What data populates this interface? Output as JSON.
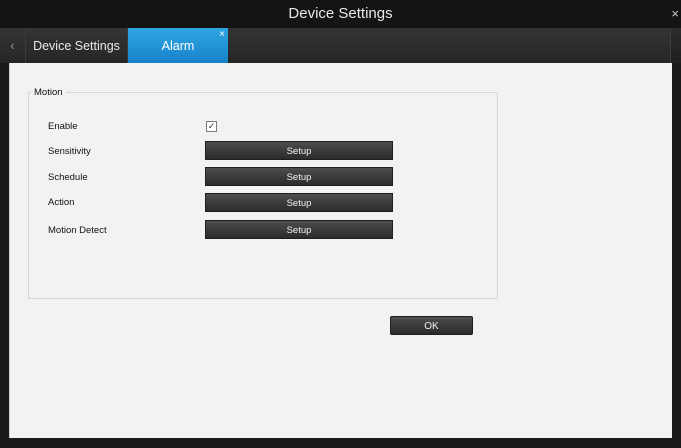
{
  "window": {
    "title": "Device Settings",
    "close_glyph": "×"
  },
  "tabbar": {
    "nav_left_glyph": "‹",
    "tabs": [
      {
        "label": "Device Settings"
      },
      {
        "label": "Alarm",
        "close_glyph": "×"
      }
    ],
    "active_tab_color": "#1e94d8"
  },
  "motion": {
    "group_title": "Motion",
    "enable": {
      "label": "Enable",
      "checked": true,
      "check_glyph": "✓"
    },
    "rows": [
      {
        "label": "Sensitivity",
        "button": "Setup"
      },
      {
        "label": "Schedule",
        "button": "Setup"
      },
      {
        "label": "Action",
        "button": "Setup"
      },
      {
        "label": "Motion Detect",
        "button": "Setup"
      }
    ]
  },
  "footer": {
    "ok_label": "OK"
  }
}
